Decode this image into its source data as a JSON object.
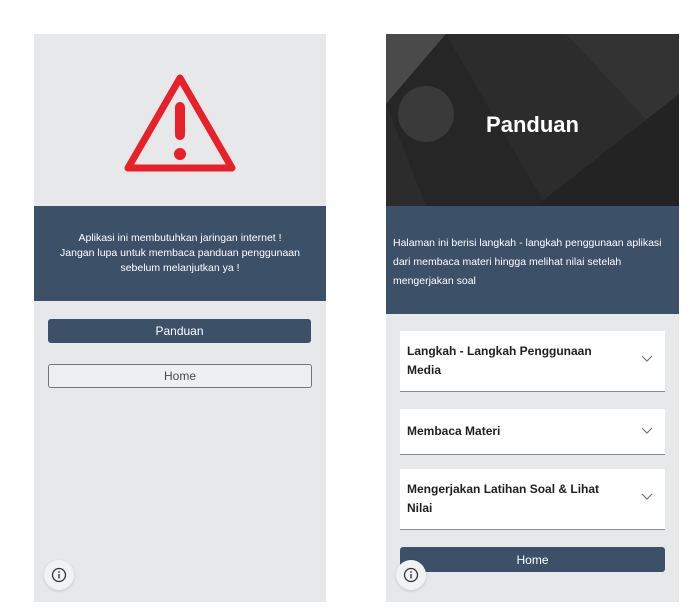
{
  "left_screen": {
    "icon": "warning-triangle-icon",
    "notice_text": "Aplikasi ini membutuhkan jaringan internet ! Jangan lupa untuk membaca panduan penggunaan sebelum melanjutkan ya !",
    "panduan_button": "Panduan",
    "home_button": "Home",
    "info_icon": "info-icon"
  },
  "right_screen": {
    "title": "Panduan",
    "description": "Halaman ini berisi langkah - langkah penggunaan aplikasi dari membaca materi hingga melihat nilai setelah mengerjakan soal",
    "accordion": [
      {
        "label": "Langkah - Langkah Penggunaan Media",
        "icon": "chevron-down-icon"
      },
      {
        "label": "Membaca Materi",
        "icon": "chevron-down-icon"
      },
      {
        "label": "Mengerjakan Latihan Soal & Lihat Nilai",
        "icon": "chevron-down-icon"
      }
    ],
    "home_button": "Home",
    "info_icon": "info-icon"
  },
  "colors": {
    "banner": "#3c5068",
    "screen_bg": "#e7e8ea",
    "warning": "#e8202a",
    "hero_bg": "#2c2c2c"
  }
}
